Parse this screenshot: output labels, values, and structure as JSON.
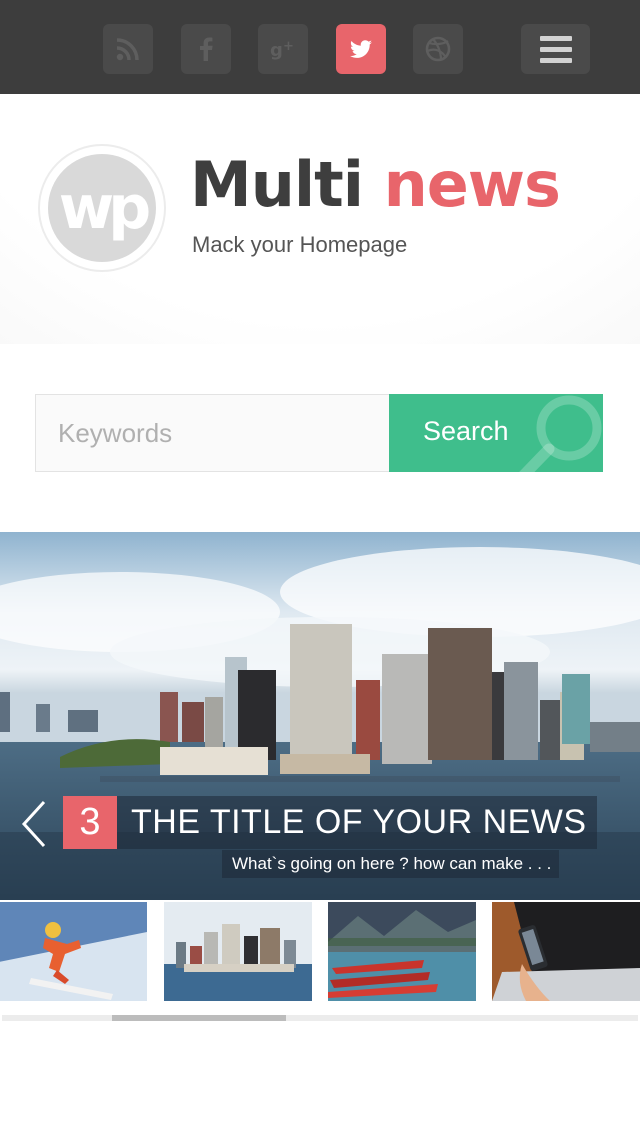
{
  "social": {
    "items": [
      {
        "name": "rss",
        "active": false
      },
      {
        "name": "facebook",
        "active": false
      },
      {
        "name": "google-plus",
        "active": false
      },
      {
        "name": "twitter",
        "active": true
      },
      {
        "name": "dribbble",
        "active": false
      }
    ],
    "menu_icon": "hamburger-menu-icon",
    "colors": {
      "bar": "#3d3d3d",
      "button": "#4a4a4a",
      "active": "#e8656b",
      "icon": "#5e5e5e"
    }
  },
  "header": {
    "logo_text": "wp",
    "brand_first": "Multi",
    "brand_second": "news",
    "tagline": "Mack your Homepage",
    "colors": {
      "brand_dark": "#3e3e3e",
      "brand_accent": "#e8656b"
    }
  },
  "search": {
    "placeholder": "Keywords",
    "value": "",
    "button_label": "Search",
    "colors": {
      "button": "#3fbe8c"
    }
  },
  "slider": {
    "number": "3",
    "title": "THE TITLE OF YOUR NEWS",
    "subtitle": "What`s going on here ? how can make . . .",
    "prev_icon": "chevron-left-icon"
  },
  "thumbnails": [
    {
      "name": "snowboarder"
    },
    {
      "name": "city-skyline"
    },
    {
      "name": "lake-boats"
    },
    {
      "name": "phone-laptop"
    }
  ],
  "scroll": {
    "position": 0.18,
    "visible_fraction": 0.27
  }
}
